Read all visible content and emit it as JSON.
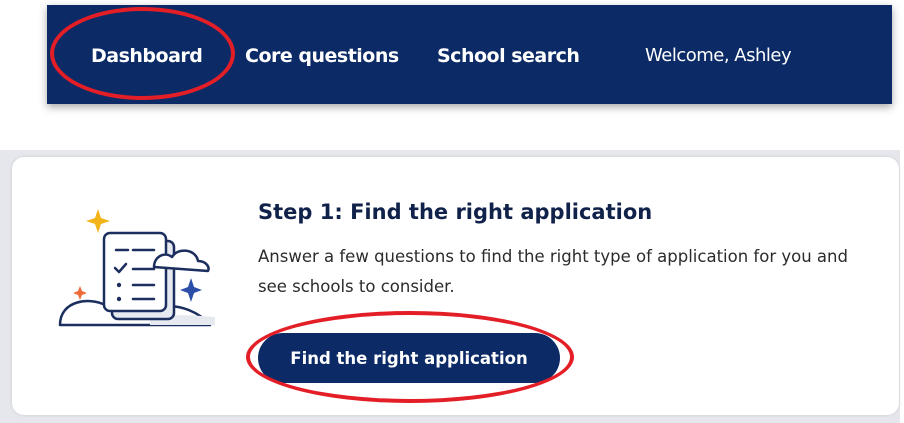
{
  "nav": {
    "items": [
      {
        "label": "Dashboard"
      },
      {
        "label": "Core questions"
      },
      {
        "label": "School search"
      }
    ],
    "welcome": "Welcome, Ashley"
  },
  "card": {
    "title": "Step 1: Find the right application",
    "description": "Answer a few questions to find the right type of application for you and see schools to consider.",
    "button_label": "Find the right application",
    "illustration_icon": "checklist-clouds-icon"
  },
  "colors": {
    "nav_bg": "#0b2a66",
    "button_bg": "#0b2a66",
    "annotation": "#e41e26",
    "sparkle_gold": "#f2b418",
    "sparkle_blue": "#2b4fa8",
    "sparkle_orange": "#ef6b3c"
  }
}
